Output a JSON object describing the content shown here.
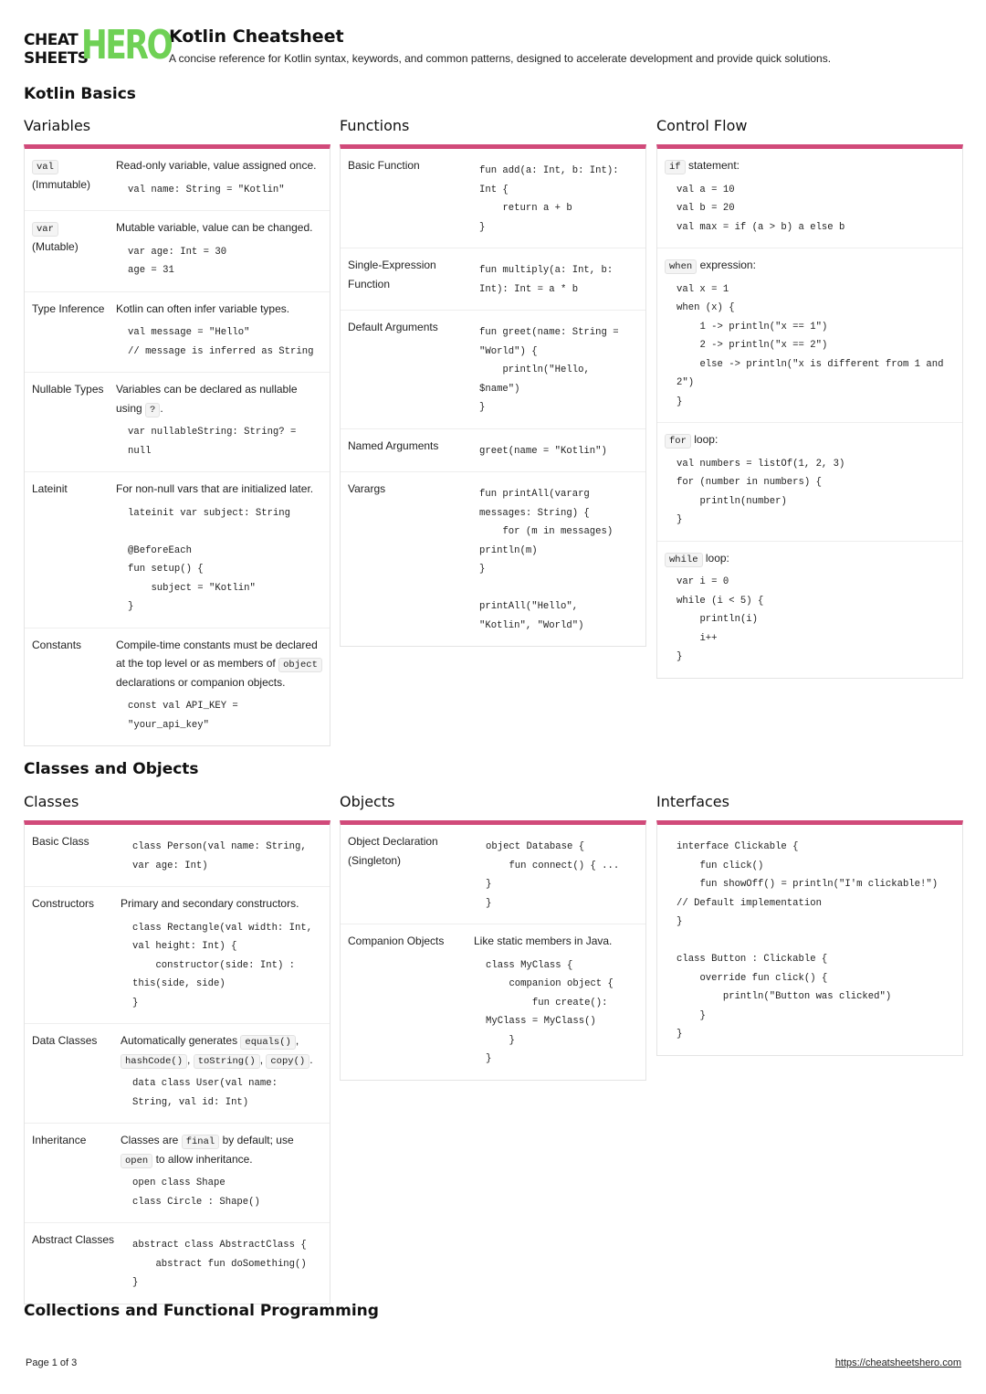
{
  "header": {
    "logo_left_line1": "CHEAT",
    "logo_left_line2": "SHEETS",
    "logo_right": "HERO",
    "title": "Kotlin Cheatsheet",
    "description": "A concise reference for Kotlin syntax, keywords, and common patterns, designed to accelerate development and provide quick solutions."
  },
  "sections": {
    "basics": "Kotlin Basics",
    "classes": "Classes and Objects",
    "collections": "Collections and Functional Programming"
  },
  "variables": {
    "title": "Variables",
    "rows": [
      {
        "chip": "val",
        "label": "(Immutable)",
        "desc": "Read-only variable, value assigned once.",
        "code": "val name: String = \"Kotlin\""
      },
      {
        "chip": "var",
        "label": "(Mutable)",
        "desc": "Mutable variable, value can be changed.",
        "code": "var age: Int = 30\nage = 31"
      },
      {
        "label": "Type Inference",
        "desc": "Kotlin can often infer variable types.",
        "code": "val message = \"Hello\"\n// message is inferred as String"
      },
      {
        "label": "Nullable Types",
        "desc_pre": "Variables can be declared as nullable using",
        "desc_chip": "?",
        "desc_post": ".",
        "code": "var nullableString: String? =\nnull"
      },
      {
        "label": "Lateinit",
        "desc": "For non-null vars that are initialized later.",
        "code": "lateinit var subject: String\n\n@BeforeEach\nfun setup() {\n    subject = \"Kotlin\"\n}"
      },
      {
        "label": "Constants",
        "desc_pre": "Compile-time constants must be declared at the top level or as members of",
        "desc_chip": "object",
        "desc_post": "declarations or companion objects.",
        "code": "const val API_KEY =\n\"your_api_key\""
      }
    ]
  },
  "functions": {
    "title": "Functions",
    "rows": [
      {
        "label": "Basic Function",
        "code": "fun add(a: Int, b: Int):\nInt {\n    return a + b\n}"
      },
      {
        "label": "Single-Expression Function",
        "code": "fun multiply(a: Int, b:\nInt): Int = a * b"
      },
      {
        "label": "Default Arguments",
        "code": "fun greet(name: String =\n\"World\") {\n    println(\"Hello,\n$name\")\n}"
      },
      {
        "label": "Named Arguments",
        "code": "greet(name = \"Kotlin\")"
      },
      {
        "label": "Varargs",
        "code": "fun printAll(vararg\nmessages: String) {\n    for (m in messages)\nprintln(m)\n}\n\nprintAll(\"Hello\",\n\"Kotlin\", \"World\")"
      }
    ]
  },
  "control_flow": {
    "title": "Control Flow",
    "rows": [
      {
        "chip": "if",
        "head": "statement:",
        "code": "val a = 10\nval b = 20\nval max = if (a > b) a else b"
      },
      {
        "chip": "when",
        "head": "expression:",
        "code": "val x = 1\nwhen (x) {\n    1 -> println(\"x == 1\")\n    2 -> println(\"x == 2\")\n    else -> println(\"x is different from 1 and\n2\")\n}"
      },
      {
        "chip": "for",
        "head": "loop:",
        "code": "val numbers = listOf(1, 2, 3)\nfor (number in numbers) {\n    println(number)\n}"
      },
      {
        "chip": "while",
        "head": "loop:",
        "code": "var i = 0\nwhile (i < 5) {\n    println(i)\n    i++\n}"
      }
    ]
  },
  "classes": {
    "title": "Classes",
    "rows": [
      {
        "label": "Basic Class",
        "code": "class Person(val name: String,\nvar age: Int)"
      },
      {
        "label": "Constructors",
        "desc": "Primary and secondary constructors.",
        "code": "class Rectangle(val width: Int,\nval height: Int) {\n    constructor(side: Int) :\nthis(side, side)\n}"
      },
      {
        "label": "Data Classes",
        "desc_pre": "Automatically generates",
        "chips": [
          "equals()",
          "hashCode()",
          "toString()",
          "copy()"
        ],
        "code": "data class User(val name:\nString, val id: Int)"
      },
      {
        "label": "Inheritance",
        "desc_pre": "Classes are",
        "chip1": "final",
        "desc_mid": "by default; use",
        "chip2": "open",
        "desc_post": "to allow inheritance.",
        "code": "open class Shape\nclass Circle : Shape()"
      },
      {
        "label": "Abstract Classes",
        "code": "abstract class AbstractClass {\n    abstract fun doSomething()\n}"
      }
    ]
  },
  "objects": {
    "title": "Objects",
    "rows": [
      {
        "label": "Object Declaration (Singleton)",
        "code": "object Database {\n    fun connect() { ...\n}\n}"
      },
      {
        "label": "Companion Objects",
        "desc": "Like static members in Java.",
        "code": "class MyClass {\n    companion object {\n        fun create():\nMyClass = MyClass()\n    }\n}"
      }
    ]
  },
  "interfaces": {
    "title": "Interfaces",
    "code": "interface Clickable {\n    fun click()\n    fun showOff() = println(\"I'm clickable!\")\n// Default implementation\n}\n\nclass Button : Clickable {\n    override fun click() {\n        println(\"Button was clicked\")\n    }\n}"
  },
  "footer": {
    "page": "Page 1 of 3",
    "link": "https://cheatsheetshero.com"
  },
  "colors": {
    "accent": "#d14a7a",
    "logo_green": "#6fd155"
  }
}
